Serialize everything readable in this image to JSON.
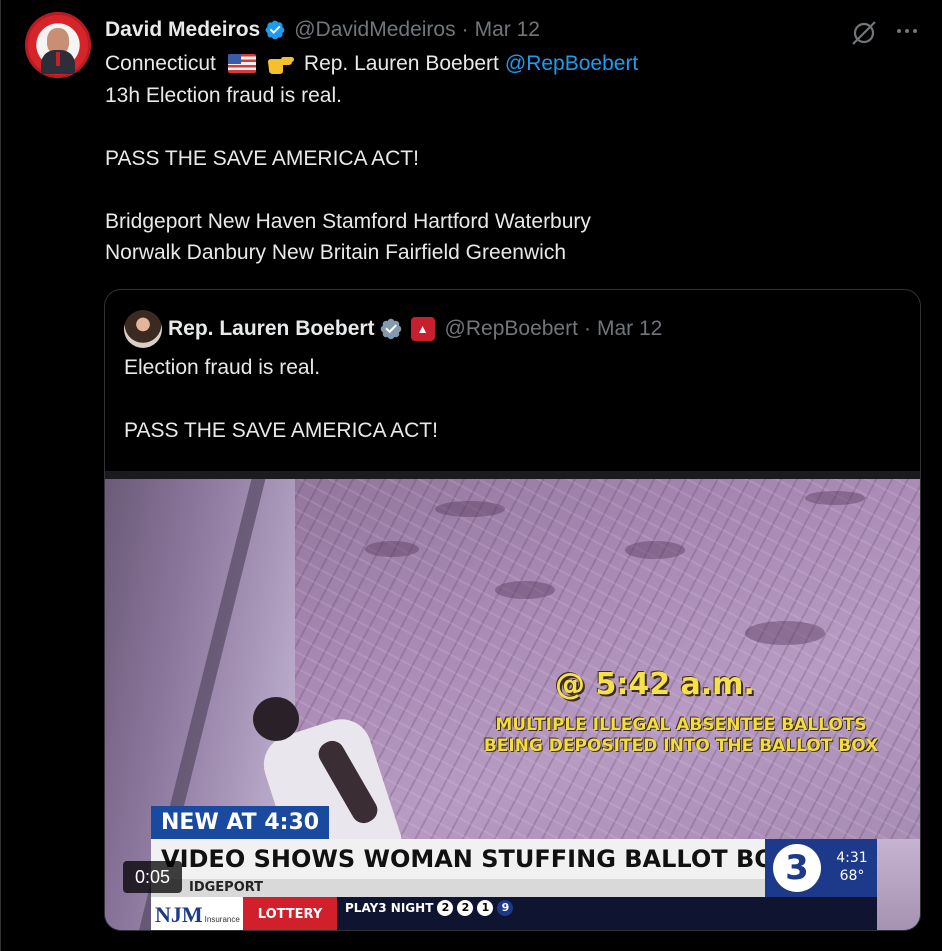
{
  "tweet": {
    "author_name": "David Medeiros",
    "author_handle": "@DavidMedeiros",
    "separator": "·",
    "date": "Mar 12",
    "line1_prefix": "Connecticut",
    "line1_name": "Rep. Lauren Boebert",
    "line1_mention": "@RepBoebert",
    "line2": "13h Election fraud is real.",
    "line3": "PASS THE SAVE AMERICA ACT!",
    "line4": "Bridgeport New Haven Stamford Hartford Waterbury",
    "line5": "Norwalk Danbury New Britain Fairfield Greenwich"
  },
  "quote": {
    "author_name": "Rep. Lauren Boebert",
    "author_handle": "@RepBoebert",
    "separator": "·",
    "date": "Mar 12",
    "line1": "Election fraud is real.",
    "line2": "PASS THE SAVE AMERICA ACT!"
  },
  "video": {
    "overlay_time": "@ 5:42 a.m.",
    "overlay_caption_1": "MULTIPLE ILLEGAL ABSENTEE BALLOTS",
    "overlay_caption_2": "BEING DEPOSITED INTO THE BALLOT BOX",
    "bug_label": "NEW AT 4:30",
    "headline": "VIDEO SHOWS WOMAN STUFFING BALLOT BOXES",
    "location": "IDGEPORT",
    "channel_number": "3",
    "channel_clock": "4:31",
    "channel_temp": "68°",
    "ticker_sponsor": "NJM",
    "ticker_sponsor_sub": "Insurance Group",
    "ticker_lottery": "LOTTERY",
    "ticker_game": "PLAY3 NIGHT",
    "ticker_balls": [
      "2",
      "2",
      "1",
      "9"
    ],
    "timer": "0:05"
  },
  "icons": {
    "verified": "verified-badge-icon",
    "grok": "grok-icon",
    "more": "more-icon",
    "flag": "us-flag-icon",
    "pointer": "pointing-hand-icon",
    "affiliate": "gop-affiliate-icon"
  },
  "colors": {
    "background": "#000000",
    "text": "#e7e9ea",
    "muted": "#71767b",
    "link": "#1d9bf0",
    "border": "#2f3336",
    "verified": "#1d9bf0",
    "affiliate_verified": "#829aab"
  }
}
